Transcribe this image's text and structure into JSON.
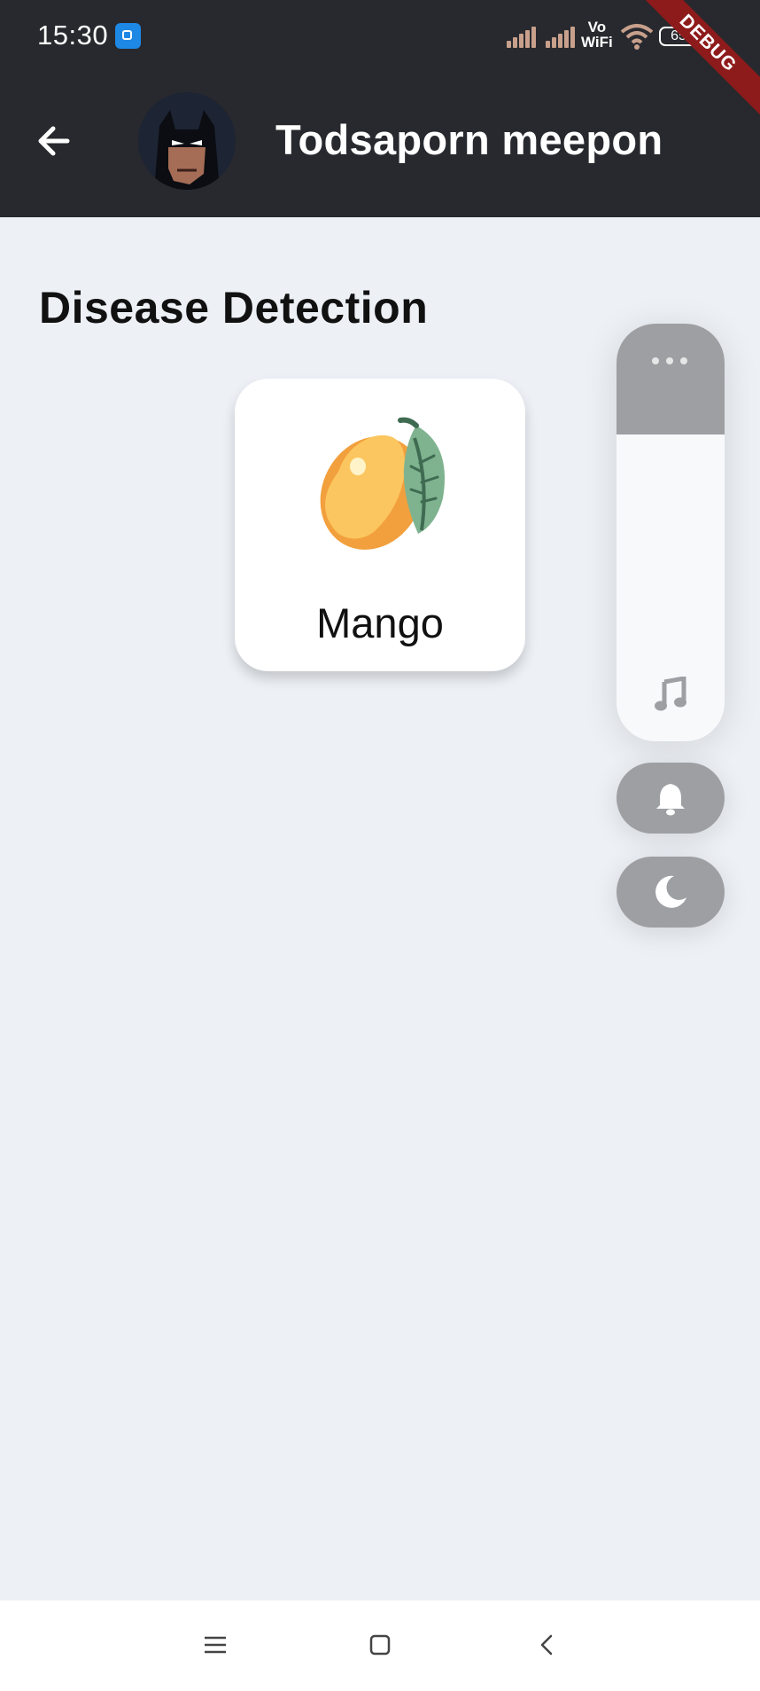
{
  "status_bar": {
    "time": "15:30",
    "network_label_top": "Vo",
    "network_label_bottom": "WiFi",
    "battery": "65",
    "debug_banner": "DEBUG"
  },
  "app_bar": {
    "title": "Todsaporn meepon",
    "back_icon": "arrow-left-icon",
    "avatar": "batman-avatar"
  },
  "main": {
    "title": "Disease Detection",
    "cards": [
      {
        "label": "Mango",
        "icon": "mango-icon"
      }
    ]
  },
  "volume_panel": {
    "level_fraction": 0.73,
    "icons": [
      "more-dots-icon",
      "music-note-icon",
      "bell-icon",
      "moon-icon"
    ]
  },
  "nav_bar": {
    "icons": [
      "menu-icon",
      "home-icon",
      "back-icon"
    ]
  },
  "colors": {
    "app_bar": "#28292e",
    "background": "#edf1f6",
    "debug_ribbon": "#8e1b1b",
    "panel_grey": "#9d9fa3"
  }
}
